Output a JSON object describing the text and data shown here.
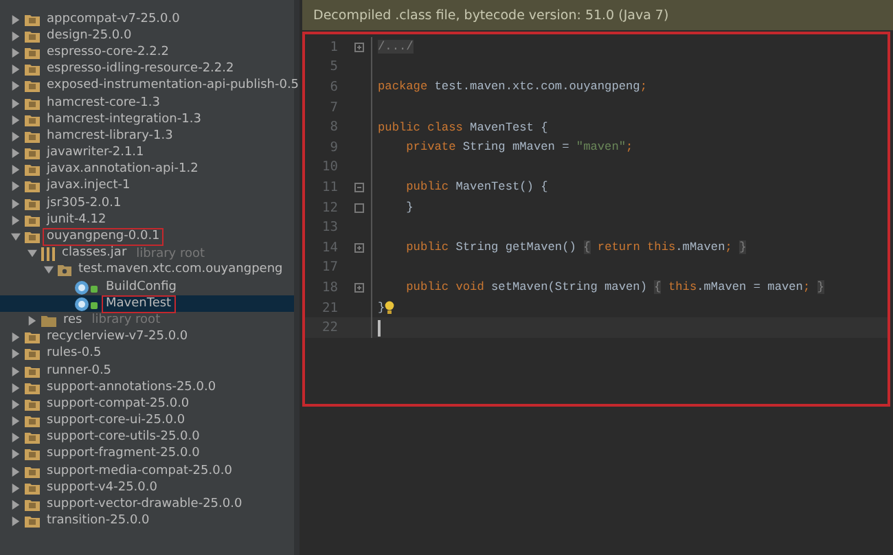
{
  "project_tree": [
    {
      "kind": "folder",
      "label": "appcompat-v7-25.0.0",
      "expanded": false
    },
    {
      "kind": "folder",
      "label": "design-25.0.0",
      "expanded": false
    },
    {
      "kind": "folder",
      "label": "espresso-core-2.2.2",
      "expanded": false
    },
    {
      "kind": "folder",
      "label": "espresso-idling-resource-2.2.2",
      "expanded": false
    },
    {
      "kind": "folder",
      "label": "exposed-instrumentation-api-publish-0.5",
      "expanded": false
    },
    {
      "kind": "folder",
      "label": "hamcrest-core-1.3",
      "expanded": false
    },
    {
      "kind": "folder",
      "label": "hamcrest-integration-1.3",
      "expanded": false
    },
    {
      "kind": "folder",
      "label": "hamcrest-library-1.3",
      "expanded": false
    },
    {
      "kind": "folder",
      "label": "javawriter-2.1.1",
      "expanded": false
    },
    {
      "kind": "folder",
      "label": "javax.annotation-api-1.2",
      "expanded": false
    },
    {
      "kind": "folder",
      "label": "javax.inject-1",
      "expanded": false
    },
    {
      "kind": "folder",
      "label": "jsr305-2.0.1",
      "expanded": false
    },
    {
      "kind": "folder",
      "label": "junit-4.12",
      "expanded": false
    },
    {
      "kind": "folder",
      "label": "ouyangpeng-0.0.1",
      "expanded": true,
      "highlighted": true,
      "children": [
        {
          "kind": "jar",
          "label": "classes.jar",
          "hint": "library root",
          "expanded": true,
          "children": [
            {
              "kind": "package",
              "label": "test.maven.xtc.com.ouyangpeng",
              "expanded": true,
              "children": [
                {
                  "kind": "class",
                  "label": "BuildConfig"
                },
                {
                  "kind": "class",
                  "label": "MavenTest",
                  "selected": true,
                  "highlighted": true
                }
              ]
            }
          ]
        },
        {
          "kind": "res",
          "label": "res",
          "hint": "library root",
          "expanded": false
        }
      ]
    },
    {
      "kind": "folder",
      "label": "recyclerview-v7-25.0.0",
      "expanded": false
    },
    {
      "kind": "folder",
      "label": "rules-0.5",
      "expanded": false
    },
    {
      "kind": "folder",
      "label": "runner-0.5",
      "expanded": false
    },
    {
      "kind": "folder",
      "label": "support-annotations-25.0.0",
      "expanded": false
    },
    {
      "kind": "folder",
      "label": "support-compat-25.0.0",
      "expanded": false
    },
    {
      "kind": "folder",
      "label": "support-core-ui-25.0.0",
      "expanded": false
    },
    {
      "kind": "folder",
      "label": "support-core-utils-25.0.0",
      "expanded": false
    },
    {
      "kind": "folder",
      "label": "support-fragment-25.0.0",
      "expanded": false
    },
    {
      "kind": "folder",
      "label": "support-media-compat-25.0.0",
      "expanded": false
    },
    {
      "kind": "folder",
      "label": "support-v4-25.0.0",
      "expanded": false
    },
    {
      "kind": "folder",
      "label": "support-vector-drawable-25.0.0",
      "expanded": false
    },
    {
      "kind": "folder",
      "label": "transition-25.0.0",
      "expanded": false
    }
  ],
  "editor": {
    "banner": "Decompiled .class file, bytecode version: 51.0 (Java 7)",
    "lines": [
      {
        "number": "1",
        "fold": {
          "kind": "expand"
        },
        "tokens": [
          {
            "kind": "folded",
            "text": "/.../"
          }
        ]
      },
      {
        "number": "5"
      },
      {
        "number": "6",
        "tokens": [
          {
            "kind": "keyword",
            "text": "package"
          },
          {
            "kind": "plain",
            "text": " test.maven.xtc.com.ouyangpeng"
          },
          {
            "kind": "keyword",
            "text": ";"
          }
        ]
      },
      {
        "number": "7"
      },
      {
        "number": "8",
        "tokens": [
          {
            "kind": "keyword",
            "text": "public class"
          },
          {
            "kind": "plain",
            "text": " MavenTest {"
          }
        ]
      },
      {
        "number": "9",
        "tokens": [
          {
            "kind": "keyword",
            "text": "    private"
          },
          {
            "kind": "plain",
            "text": " String mMaven = "
          },
          {
            "kind": "string",
            "text": "\"maven\""
          },
          {
            "kind": "keyword",
            "text": ";"
          }
        ]
      },
      {
        "number": "10"
      },
      {
        "number": "11",
        "fold": {
          "kind": "start"
        },
        "tokens": [
          {
            "kind": "keyword",
            "text": "    public"
          },
          {
            "kind": "plain",
            "text": " MavenTest() {"
          }
        ]
      },
      {
        "number": "12",
        "fold": {
          "kind": "end"
        },
        "tokens": [
          {
            "kind": "plain",
            "text": "    }"
          }
        ]
      },
      {
        "number": "13"
      },
      {
        "number": "14",
        "fold": {
          "kind": "expand"
        },
        "tokens": [
          {
            "kind": "keyword",
            "text": "    public"
          },
          {
            "kind": "plain",
            "text": " String getMaven() "
          },
          {
            "kind": "folded",
            "text": "{"
          },
          {
            "kind": "keyword",
            "text": " return this"
          },
          {
            "kind": "plain",
            "text": ".mMaven"
          },
          {
            "kind": "keyword",
            "text": "; "
          },
          {
            "kind": "folded",
            "text": "}"
          }
        ]
      },
      {
        "number": "17"
      },
      {
        "number": "18",
        "fold": {
          "kind": "expand"
        },
        "tokens": [
          {
            "kind": "keyword",
            "text": "    public void"
          },
          {
            "kind": "plain",
            "text": " setMaven(String maven) "
          },
          {
            "kind": "folded",
            "text": "{"
          },
          {
            "kind": "keyword",
            "text": " this"
          },
          {
            "kind": "plain",
            "text": ".mMaven = maven"
          },
          {
            "kind": "keyword",
            "text": "; "
          },
          {
            "kind": "folded",
            "text": "}"
          }
        ]
      },
      {
        "number": "21",
        "bulb": true,
        "tokens": [
          {
            "kind": "plain",
            "text": "}"
          }
        ]
      },
      {
        "number": "22",
        "current": true
      }
    ]
  }
}
